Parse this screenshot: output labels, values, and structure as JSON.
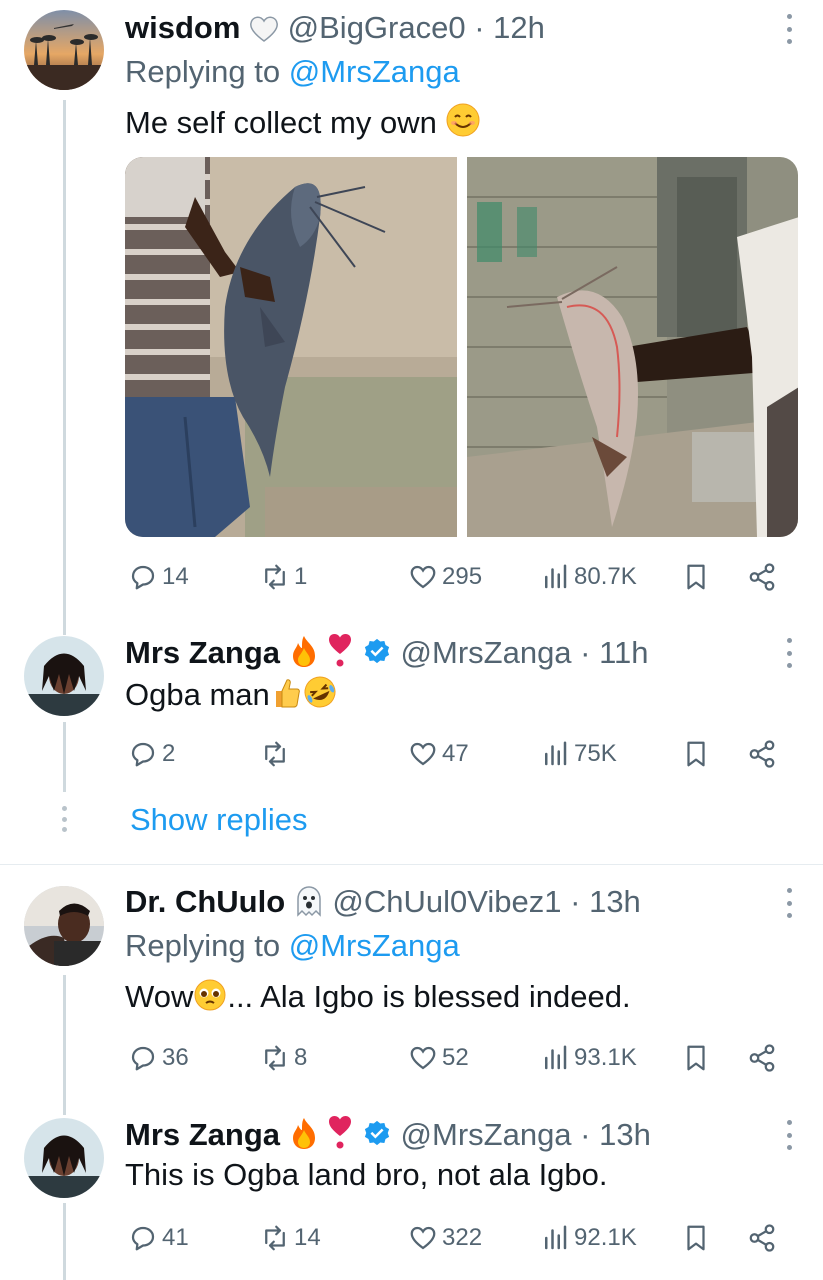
{
  "tweets": [
    {
      "name": "wisdom",
      "name_emoji": "white-heart-emoji",
      "handle": "@BigGrace0",
      "time": "· 12h",
      "replying_prefix": "Replying to",
      "replying_to": "@MrsZanga",
      "text": "Me self collect my own",
      "text_emoji": "smiling-face-emoji",
      "stats": {
        "replies": "14",
        "retweets": "1",
        "likes": "295",
        "views": "80.7K"
      }
    },
    {
      "name": "Mrs Zanga",
      "name_emoji": "fire-emoji heart-exclamation-emoji",
      "handle": "@MrsZanga",
      "time": "· 11h",
      "text": "Ogba man",
      "text_emoji": "thumbs-up-emoji rolling-laughing-emoji",
      "stats": {
        "replies": "2",
        "retweets": "",
        "likes": "47",
        "views": "75K"
      }
    },
    {
      "name": "Dr. ChUulo",
      "name_emoji": "ghost-emoji",
      "handle": "@ChUul0Vibez1",
      "time": "· 13h",
      "replying_prefix": "Replying to",
      "replying_to": "@MrsZanga",
      "text": "Wow",
      "text_after": "... Ala Igbo is blessed indeed.",
      "text_emoji": "pleading-face-emoji",
      "stats": {
        "replies": "36",
        "retweets": "8",
        "likes": "52",
        "views": "93.1K"
      }
    },
    {
      "name": "Mrs Zanga",
      "name_emoji": "fire-emoji heart-exclamation-emoji",
      "handle": "@MrsZanga",
      "time": "· 13h",
      "text": "This is Ogba land bro, not ala Igbo.",
      "stats": {
        "replies": "41",
        "retweets": "14",
        "likes": "322",
        "views": "92.1K"
      }
    }
  ],
  "show_replies": "Show replies",
  "colors": {
    "link": "#1d9bf0",
    "verified": "#1d9bf0",
    "muted": "#536471",
    "text": "#0f1419"
  }
}
